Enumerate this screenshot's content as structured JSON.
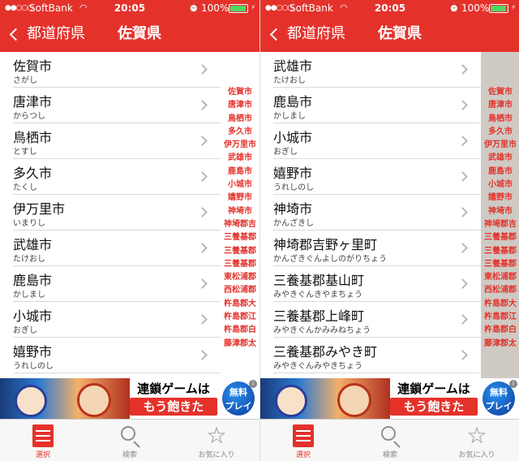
{
  "screens": [
    {
      "status": {
        "signal": "●●○○○",
        "carrier": "SoftBank",
        "time": "20:05",
        "battery": "100%"
      },
      "nav": {
        "back_label": "都道府県",
        "title": "佐賀県"
      },
      "rows": [
        {
          "name": "佐賀市",
          "kana": "さがし"
        },
        {
          "name": "唐津市",
          "kana": "からつし"
        },
        {
          "name": "鳥栖市",
          "kana": "とすし"
        },
        {
          "name": "多久市",
          "kana": "たくし"
        },
        {
          "name": "伊万里市",
          "kana": "いまりし"
        },
        {
          "name": "武雄市",
          "kana": "たけおし"
        },
        {
          "name": "鹿島市",
          "kana": "かしまし"
        },
        {
          "name": "小城市",
          "kana": "おぎし"
        },
        {
          "name": "嬉野市",
          "kana": "うれしのし"
        }
      ]
    },
    {
      "status": {
        "signal": "●●○○○",
        "carrier": "SoftBank",
        "time": "20:05",
        "battery": "100%"
      },
      "nav": {
        "back_label": "都道府県",
        "title": "佐賀県"
      },
      "rows": [
        {
          "name": "武雄市",
          "kana": "たけおし"
        },
        {
          "name": "鹿島市",
          "kana": "かしまし"
        },
        {
          "name": "小城市",
          "kana": "おぎし"
        },
        {
          "name": "嬉野市",
          "kana": "うれしのし"
        },
        {
          "name": "神埼市",
          "kana": "かんざきし"
        },
        {
          "name": "神埼郡吉野ヶ里町",
          "kana": "かんざきぐんよしのがりちょう"
        },
        {
          "name": "三養基郡基山町",
          "kana": "みやきぐんきやまちょう"
        },
        {
          "name": "三養基郡上峰町",
          "kana": "みやきぐんかみみねちょう"
        },
        {
          "name": "三養基郡みやき町",
          "kana": "みやきぐんみやきちょう"
        }
      ]
    }
  ],
  "index": [
    "佐賀市",
    "唐津市",
    "鳥栖市",
    "多久市",
    "伊万里市",
    "武雄市",
    "鹿島市",
    "小城市",
    "嬉野市",
    "神埼市",
    "神埼郡吉",
    "三養基郡",
    "三養基郡",
    "三養基郡",
    "東松浦郡",
    "西松浦郡",
    "杵島郡大",
    "杵島郡江",
    "杵島郡白",
    "藤津郡太"
  ],
  "ad": {
    "line1": "連鎖ゲームは",
    "line2": "もう飽きた",
    "badge_line1": "無料",
    "badge_line2": "プレイ",
    "info": "i"
  },
  "tabs": [
    {
      "label": "選択",
      "icon": "menu-icon",
      "active": true
    },
    {
      "label": "検索",
      "icon": "search-icon",
      "active": false
    },
    {
      "label": "お気に入り",
      "icon": "star-icon",
      "active": false
    }
  ],
  "colors": {
    "accent": "#e4322b",
    "index_shade": "#cfcac4"
  }
}
